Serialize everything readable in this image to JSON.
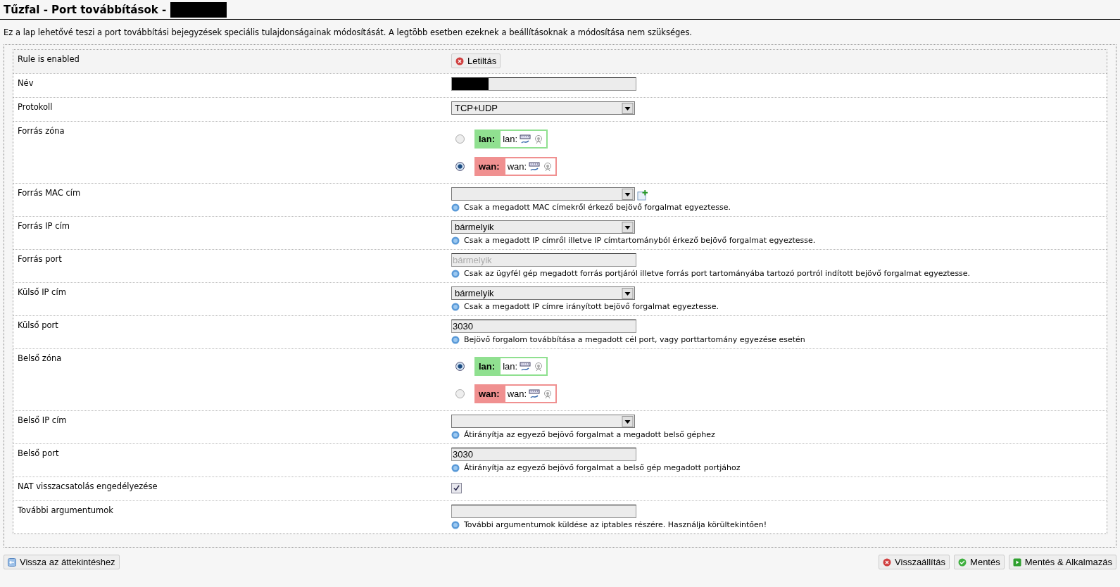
{
  "title": "Tűzfal - Port továbbítások -",
  "description": "Ez a lap lehetővé teszi a port továbbítási bejegyzések speciális tulajdonságainak módosítását. A legtöbb esetben ezeknek a beállításoknak a módosítása nem szükséges.",
  "fields": [
    {
      "kind": "button",
      "label": "Rule is enabled",
      "button": "Letiltás"
    },
    {
      "kind": "text",
      "label": "Név",
      "redacted": true
    },
    {
      "kind": "select",
      "label": "Protokoll",
      "value": "TCP+UDP"
    },
    {
      "kind": "zone",
      "label": "Forrás zóna",
      "zones": [
        {
          "name": "lan:",
          "network": "lan:",
          "color": "#90e090",
          "selected": false
        },
        {
          "name": "wan:",
          "network": "wan:",
          "color": "#f09090",
          "selected": true
        }
      ]
    },
    {
      "kind": "select",
      "label": "Forrás MAC cím",
      "add": true,
      "hint": "Csak a megadott MAC címekről érkező bejövő forgalmat egyeztesse."
    },
    {
      "kind": "select",
      "label": "Forrás IP cím",
      "value": "bármelyik",
      "hint": "Csak a megadott IP címről illetve IP címtartományból érkező bejövő forgalmat egyeztesse."
    },
    {
      "kind": "text",
      "label": "Forrás port",
      "placeholder": "bármelyik",
      "hint": "Csak az ügyfél gép megadott forrás portjáról illetve forrás port tartományába tartozó portról indított bejövő forgalmat egyeztesse."
    },
    {
      "kind": "select",
      "label": "Külső IP cím",
      "value": "bármelyik",
      "hint": "Csak a megadott IP címre irányított bejövő forgalmat egyeztesse."
    },
    {
      "kind": "text",
      "label": "Külső port",
      "value": "3030",
      "hint": "Bejövő forgalom továbbítása a megadott cél port, vagy porttartomány egyezése esetén"
    },
    {
      "kind": "zone",
      "label": "Belső zóna",
      "zones": [
        {
          "name": "lan:",
          "network": "lan:",
          "color": "#90e090",
          "selected": true
        },
        {
          "name": "wan:",
          "network": "wan:",
          "color": "#f09090",
          "selected": false
        }
      ]
    },
    {
      "kind": "select",
      "label": "Belső IP cím",
      "hint": "Átirányítja az egyező bejövő forgalmat a megadott belső géphez"
    },
    {
      "kind": "text",
      "label": "Belső port",
      "value": "3030",
      "hint": "Átirányítja az egyező bejövő forgalmat a belső gép megadott portjához"
    },
    {
      "kind": "checkbox",
      "label": "NAT visszacsatolás engedélyezése",
      "checked": true
    },
    {
      "kind": "text",
      "label": "További argumentumok",
      "hint": "További argumentumok küldése az iptables részére. Használja körültekintően!"
    }
  ],
  "footer": {
    "back": "Vissza az áttekintéshez",
    "buttons": [
      {
        "kind": "reset",
        "label": "Visszaállítás"
      },
      {
        "kind": "save",
        "label": "Mentés"
      },
      {
        "kind": "apply",
        "label": "Mentés & Alkalmazás"
      }
    ]
  }
}
